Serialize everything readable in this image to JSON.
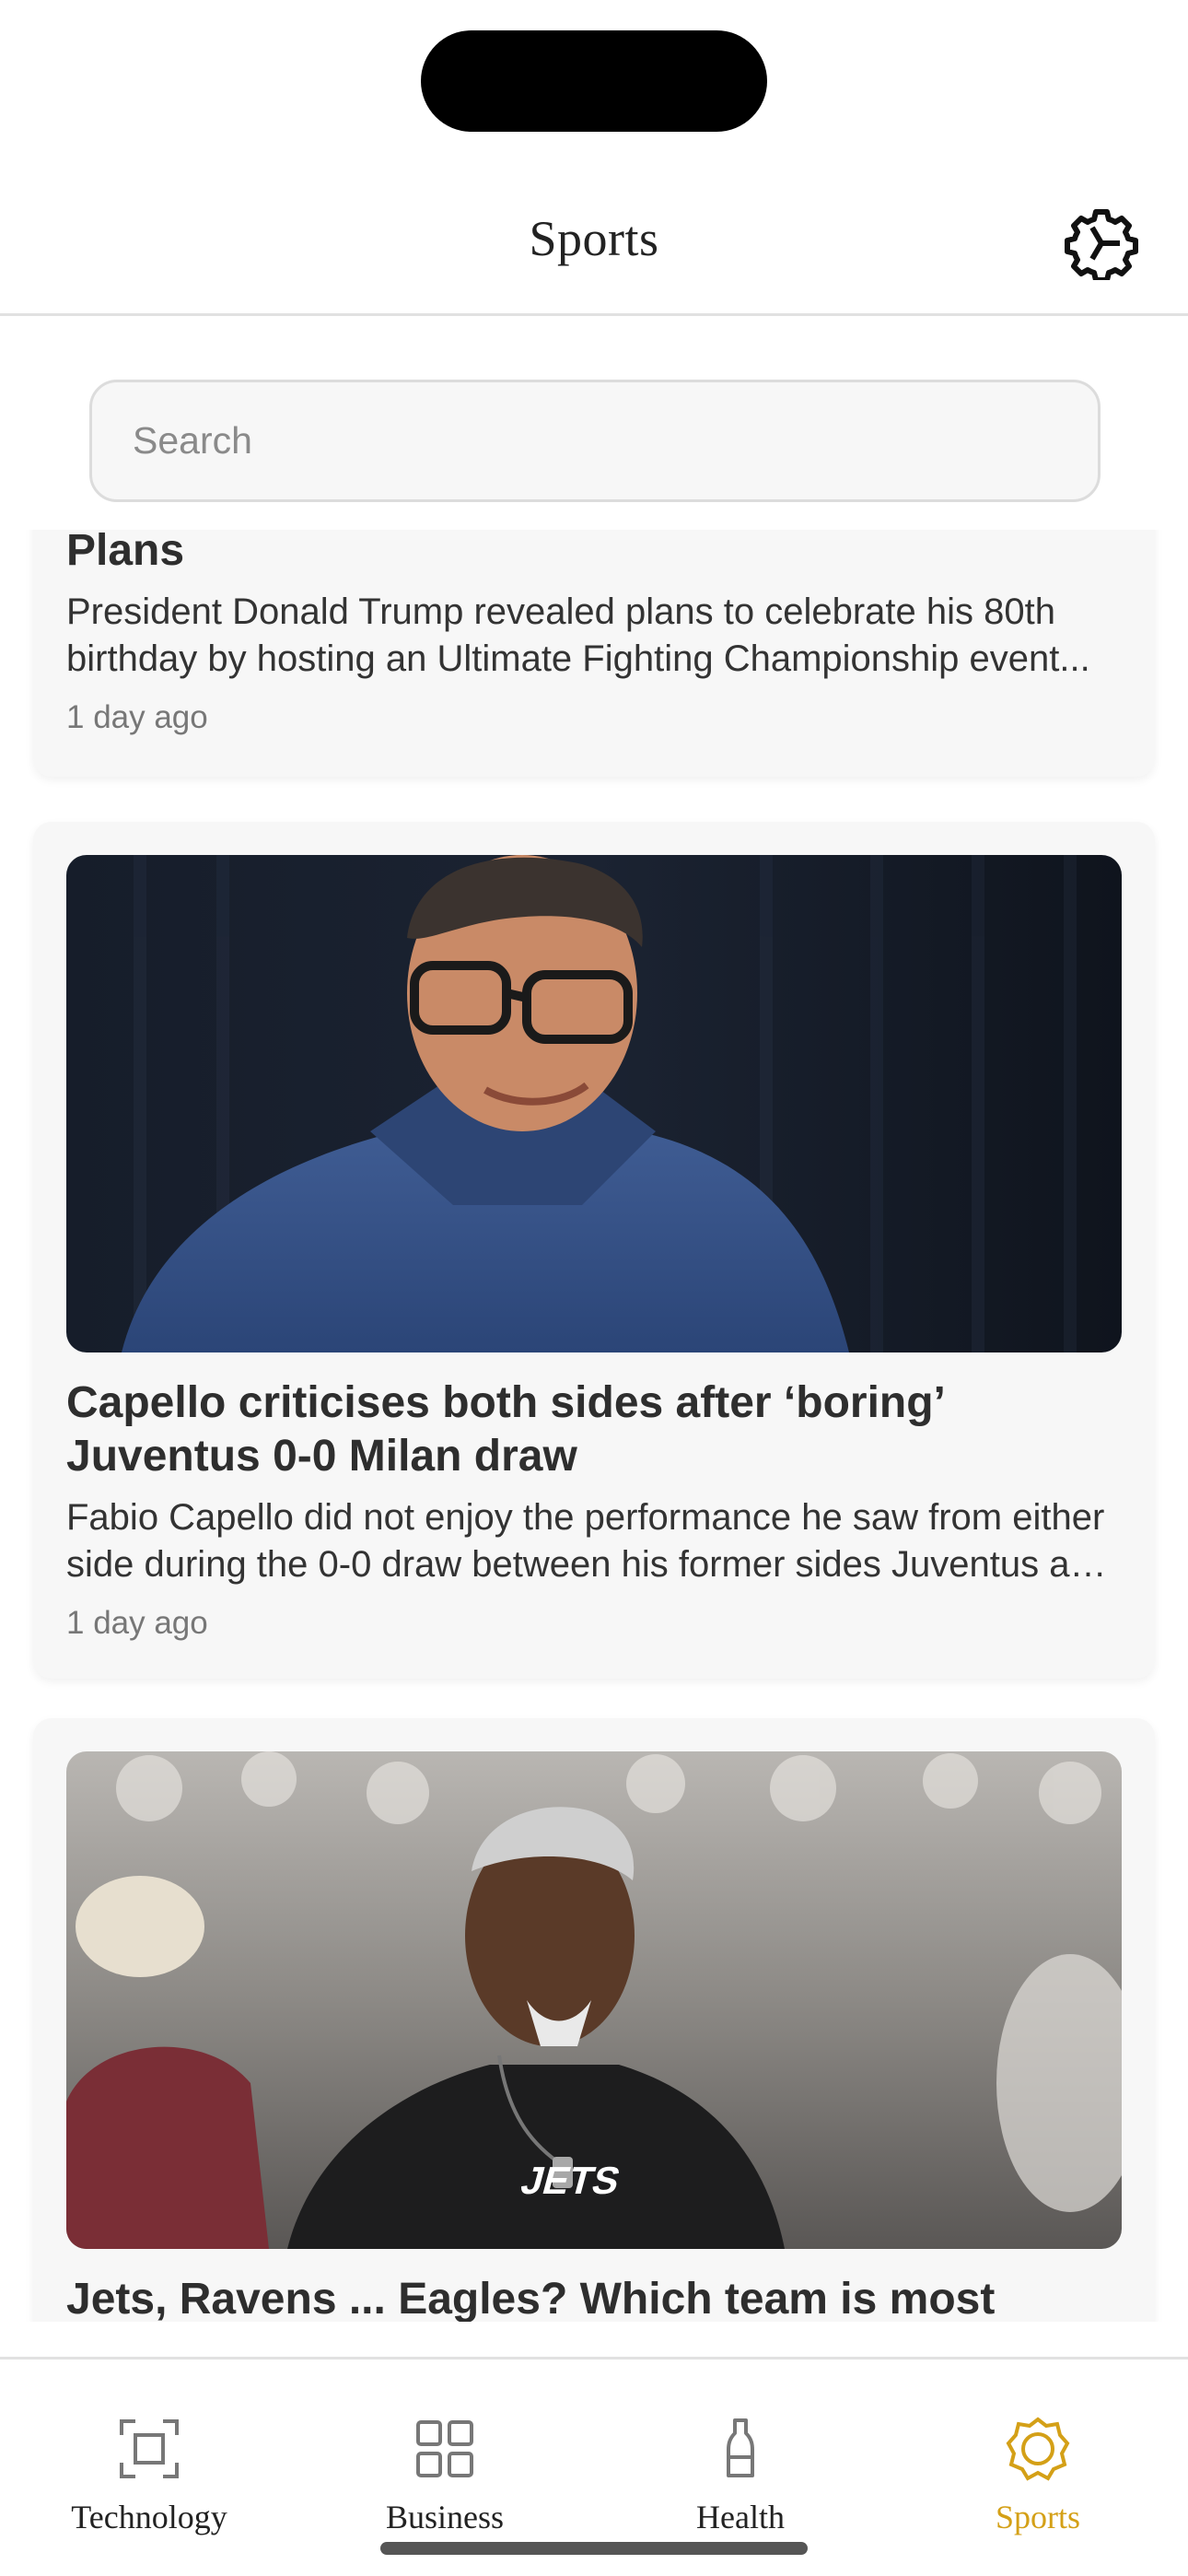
{
  "header": {
    "title": "Sports",
    "settings_icon": "settings-gear-icon"
  },
  "search": {
    "placeholder": "Search",
    "value": ""
  },
  "articles": [
    {
      "title": "Plans",
      "description": "President Donald Trump revealed plans to celebrate his 80th birthday by hosting an Ultimate Fighting Championship event...",
      "time": "1 day ago"
    },
    {
      "title": "Capello criticises both sides after ‘boring’ Juventus 0-0 Milan draw",
      "description": "Fabio Capello did not enjoy the performance he saw from either side during the 0-0 draw between his former sides Juventus and Milan...",
      "time": "1 day ago",
      "image_alt": "Photo of Fabio Capello smiling in a navy quarter-zip"
    },
    {
      "title": "Jets, Ravens ... Eagles? Which team is most",
      "image_alt": "Photo of a coach in a black Jets shirt smiling on the sideline"
    }
  ],
  "tabs": [
    {
      "label": "Technology",
      "icon": "viewfinder-icon",
      "active": false
    },
    {
      "label": "Business",
      "icon": "grid-icon",
      "active": false
    },
    {
      "label": "Health",
      "icon": "bottle-icon",
      "active": false
    },
    {
      "label": "Sports",
      "icon": "ball-icon",
      "active": true
    }
  ],
  "colors": {
    "accent": "#d4a017",
    "card_bg": "#f7f7f7",
    "divider": "#e1e1e1"
  }
}
